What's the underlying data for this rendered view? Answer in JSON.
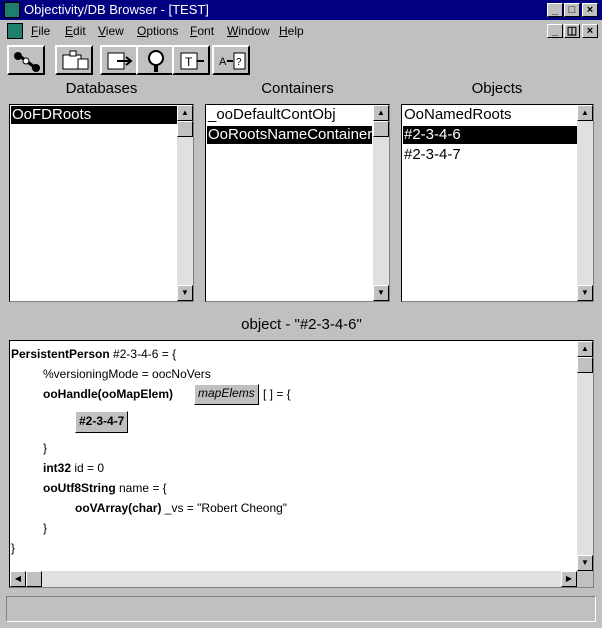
{
  "window": {
    "title": "Objectivity/DB Browser - [TEST]"
  },
  "menu": [
    "File",
    "Edit",
    "View",
    "Options",
    "Font",
    "Window",
    "Help"
  ],
  "toolbar": [
    "connect-icon",
    "container-icon",
    "move-icon",
    "query-icon",
    "type-icon",
    "navigate-icon"
  ],
  "panes": {
    "databases": {
      "label": "Databases",
      "items": [
        {
          "text": "OoFDRoots",
          "selected": true
        }
      ]
    },
    "containers": {
      "label": "Containers",
      "items": [
        {
          "text": "_ooDefaultContObj",
          "selected": false
        },
        {
          "text": "OoRootsNameContainer",
          "selected": true
        }
      ]
    },
    "objects": {
      "label": "Objects",
      "items": [
        {
          "text": "OoNamedRoots",
          "selected": false
        },
        {
          "text": "#2-3-4-6",
          "selected": true
        },
        {
          "text": "#2-3-4-7",
          "selected": false
        }
      ]
    }
  },
  "object_view": {
    "caption": "object - \"#2-3-4-6\"",
    "line1_type": "PersistentPerson",
    "line1_rest": " #2-3-4-6 = {",
    "line2": "%versioningMode = oocNoVers",
    "line3_type": "ooHandle(ooMapElem)",
    "line3_button": "mapElems",
    "line3_rest": "[ ] = {",
    "line4_button": "#2-3-4-7",
    "line5": "}",
    "line6_type": "int32",
    "line6_rest": " id = 0",
    "line7_type": "ooUtf8String",
    "line7_rest": " name = {",
    "line8_type": "ooVArray(char)",
    "line8_rest": " _vs = \"Robert Cheong\"",
    "line9": "}",
    "line10": "}"
  },
  "status_text": ""
}
